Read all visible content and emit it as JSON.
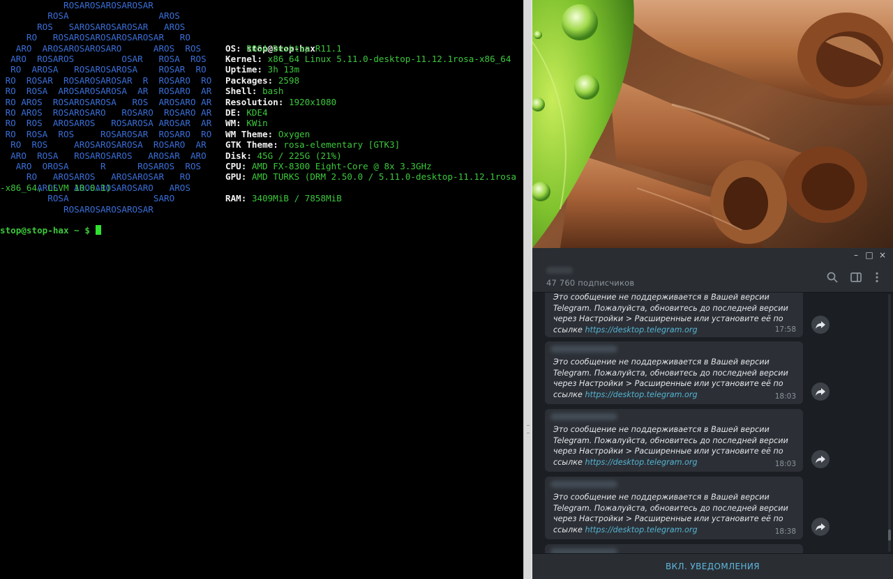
{
  "terminal": {
    "logo_lines": [
      "            ROSAROSAROSAROSAR",
      "         ROSA                 AROS",
      "       ROS   SAROSAROSAROSAR   AROS",
      "     RO   ROSAROSAROSAROSAROSAR   RO",
      "   ARO  AROSAROSAROSARO      AROS  ROS",
      "  ARO  ROSAROS         OSAR   ROSA  ROS",
      "  RO  AROSA   ROSAROSAROSA    ROSAR  RO",
      " RO  ROSAR  ROSAROSAROSAR  R  ROSARO  RO",
      " RO  ROSA  AROSAROSAROSA  AR  ROSARO  AR",
      " RO AROS  ROSAROSAROSA   ROS  AROSARO AR",
      " RO AROS  ROSAROSARO   ROSARO  ROSARO AR",
      " RO  ROS  AROSAROS   ROSAROSA AROSAR  AR",
      " RO  ROSA  ROS     ROSAROSAR  ROSARO  RO",
      "  RO  ROS     AROSAROSAROSA  ROSARO  AR",
      "  ARO  ROSA   ROSAROSAROS   AROSAR  ARO",
      "   ARO  OROSA      R      ROSAROS  ROS",
      "     RO   AROSAROS   AROSAROSAR   RO",
      "       AROS   AROSAROSAROSARO   AROS",
      "         ROSA                SARO",
      "            ROSAROSAROSAROSAR"
    ],
    "host_line": "stop@stop-hax",
    "info": [
      {
        "key": "OS:",
        "value": "ROSA Desktop R11.1"
      },
      {
        "key": "Kernel:",
        "value": "x86_64 Linux 5.11.0-desktop-11.12.1rosa-x86_64"
      },
      {
        "key": "Uptime:",
        "value": "3h 13m"
      },
      {
        "key": "Packages:",
        "value": "2598"
      },
      {
        "key": "Shell:",
        "value": "bash"
      },
      {
        "key": "Resolution:",
        "value": "1920x1080"
      },
      {
        "key": "DE:",
        "value": "KDE4"
      },
      {
        "key": "WM:",
        "value": "KWin"
      },
      {
        "key": "WM Theme:",
        "value": "Oxygen"
      },
      {
        "key": "GTK Theme:",
        "value": "rosa-elementary [GTK3]"
      },
      {
        "key": "Disk:",
        "value": "45G / 225G (21%)"
      },
      {
        "key": "CPU:",
        "value": "AMD FX-8300 Eight-Core @ 8x 3.3GHz"
      },
      {
        "key": "GPU:",
        "value": "AMD TURKS (DRM 2.50.0 / 5.11.0-desktop-11.12.1rosa"
      },
      {
        "key": "RAM:",
        "value": "3409MiB / 7858MiB"
      }
    ],
    "wrap_line": "-x86_64, LLVM 10.0.1)",
    "prompt": "stop@stop-hax ~ $"
  },
  "telegram": {
    "window_controls": {
      "minimize": "–",
      "maximize": "□",
      "close": "×"
    },
    "subscribers": "47 760 подписчиков",
    "header_icons": [
      "search-icon",
      "sidebar-toggle-icon",
      "more-vert-icon"
    ],
    "messages": [
      {
        "text": "Это сообщение не поддерживается в Вашей версии\nTelegram. Пожалуйста, обновитесь до последней версии\nчерез Настройки > Расширенные или установите её по\nссылке",
        "link": "https://desktop.telegram.org",
        "time": "17:58"
      },
      {
        "text": "Это сообщение не поддерживается в Вашей версии\nTelegram. Пожалуйста, обновитесь до последней версии\nчерез Настройки > Расширенные или установите её по\nссылке",
        "link": "https://desktop.telegram.org",
        "time": "18:03"
      },
      {
        "text": "Это сообщение не поддерживается в Вашей версии\nTelegram. Пожалуйста, обновитесь до последней версии\nчерез Настройки > Расширенные или установите её по\nссылке",
        "link": "https://desktop.telegram.org",
        "time": "18:03"
      },
      {
        "text": "Это сообщение не поддерживается в Вашей версии\nTelegram. Пожалуйста, обновитесь до последней версии\nчерез Настройки > Расширенные или установите её по\nссылке",
        "link": "https://desktop.telegram.org",
        "time": "18:38"
      }
    ],
    "notify_button": "ВКЛ. УВЕДОМЛЕНИЯ"
  },
  "colors": {
    "terminal_bg": "#000000",
    "logo_blue": "#3a6fd8",
    "value_green": "#3cc83c",
    "tg_bg": "#1e2227",
    "tg_bubble": "#2c3036",
    "tg_link": "#55b4d4",
    "tg_accent": "#5fb8e0"
  }
}
